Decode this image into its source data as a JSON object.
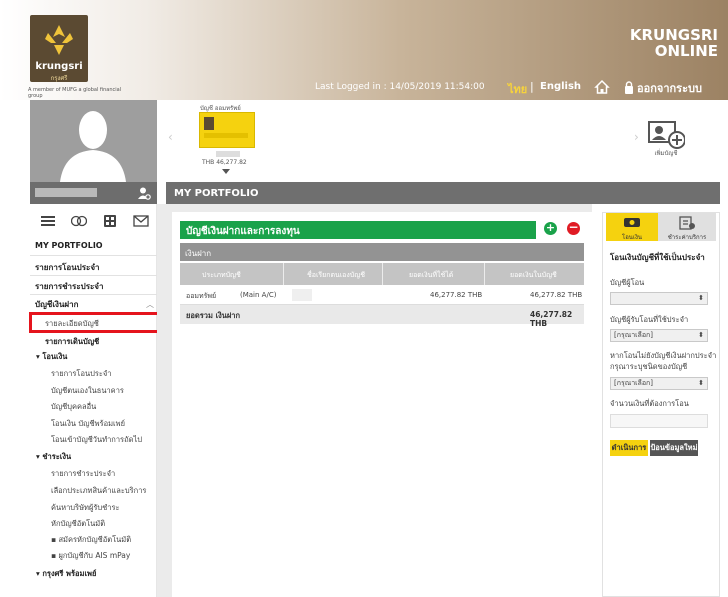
{
  "brand": {
    "line1": "KRUNGSRI",
    "line2": "ONLINE",
    "logo_name": "krungsri",
    "logo_sub": "กรุงศรี",
    "member": "A member of MUFG a global financial group"
  },
  "header": {
    "last_logged": "Last Logged in : 14/05/2019 11:54:00",
    "lang_th": "ไทย",
    "lang_sep": "|",
    "lang_en": "English",
    "logout": "ออกจากระบบ"
  },
  "carousel": {
    "account_label": "บัญชี ออมทรัพย์",
    "balance": "THB 46,277.82",
    "add_label": "เพิ่มบัญชี"
  },
  "page_title": "MY PORTFOLIO",
  "sidebar": {
    "my_portfolio": "MY PORTFOLIO",
    "transfer_list": "รายการโอนประจำ",
    "payment_list": "รายการชำระประจำ",
    "deposit": "บัญชีเงินฝาก",
    "account_detail": "รายละเอียดบัญชี",
    "statement": "รายการเดินบัญชี",
    "transfer": "โอนเงิน",
    "transfer_items": [
      "รายการโอนประจำ",
      "บัญชีตนเองในธนาคาร",
      "บัญชีบุคคลอื่น",
      "โอนเงิน บัญชีพร้อมเพย์",
      "โอนเข้าบัญชีวันทำการถัดไป"
    ],
    "pay": "ชำระเงิน",
    "pay_items": [
      "รายการชำระประจำ",
      "เลือกประเภทสินค้าและบริการ",
      "ค้นหาบริษัทผู้รับชำระ",
      "หักบัญชีอัตโนมัติ",
      "สมัครหักบัญชีอัตโนมัติ",
      "ผูกบัญชีกับ AIS mPay"
    ],
    "promptpay": "กรุงศรี พร้อมเพย์"
  },
  "main": {
    "section_title": "บัญชีเงินฝากและการลงทุน",
    "sub_title": "เงินฝาก",
    "columns": [
      "ประเภทบัญชี",
      "ชื่อเรียกตนเองบัญชี",
      "ยอดเงินที่ใช้ได้",
      "ยอดเงินในบัญชี"
    ],
    "row": {
      "type": "ออมทรัพย์",
      "main": "(Main A/C)",
      "available": "46,277.82 THB",
      "balance": "46,277.82 THB"
    },
    "total_label": "ยอดรวม เงินฝาก",
    "total_value": "46,277.82 THB",
    "plus": "+",
    "minus": "−"
  },
  "right": {
    "tab1": "โอนเงิน",
    "tab2": "ชำระค่าบริการ",
    "title": "โอนเงินบัญชีที่ใช้เป็นประจำ",
    "from_label": "บัญชีผู้โอน",
    "to_label": "บัญชีผู้รับโอนที่ใช้ประจำ",
    "to_select": "[กรุณาเลือก]",
    "note_line1": "หากโอนไม่ยังบัญชีเงินฝากประจำ",
    "note_line2": "กรุณาระบุชนิดของบัญชี",
    "note_select": "[กรุณาเลือก]",
    "amount_label": "จำนวนเงินที่ต้องการโอน",
    "btn_submit": "ดำเนินการ",
    "btn_clear": "ป้อนข้อมูลใหม่"
  }
}
